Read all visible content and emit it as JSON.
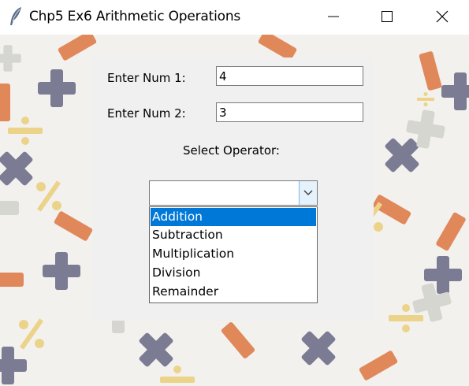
{
  "window": {
    "title": "Chp5 Ex6 Arithmetic Operations",
    "icon": "feather-icon"
  },
  "form": {
    "num1_label": "Enter Num 1:",
    "num1_value": "4",
    "num2_label": "Enter Num 2:",
    "num2_value": "3",
    "operator_label": "Select Operator:",
    "operator_value": ""
  },
  "dropdown": {
    "options": [
      "Addition",
      "Subtraction",
      "Multiplication",
      "Division",
      "Remainder"
    ],
    "highlighted": "Addition"
  },
  "colors": {
    "accent": "#0078d7",
    "panel": "#f0f0f0",
    "shape_blue": "#7b7b93",
    "shape_orange": "#e0885a",
    "shape_yellow": "#ecd38a",
    "shape_grey": "#d5d6cf"
  }
}
